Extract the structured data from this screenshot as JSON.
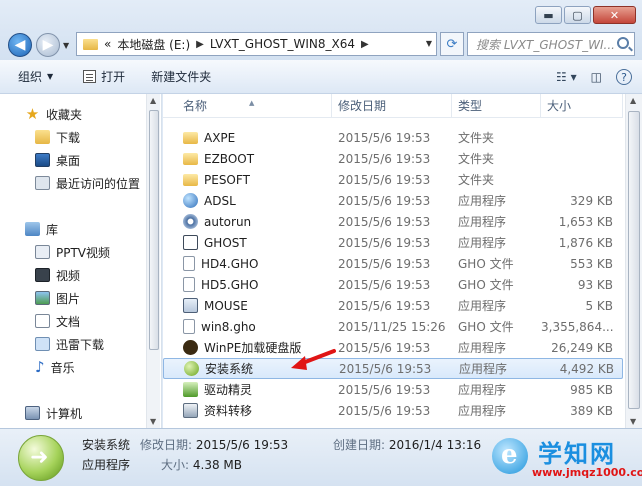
{
  "window": {
    "minimize": "▬",
    "maximize": "▢",
    "close": "✕"
  },
  "address": {
    "overflow": "«",
    "crumbs": [
      "本地磁盘 (E:)",
      "LVXT_GHOST_WIN8_X64"
    ],
    "search_placeholder": "搜索 LVXT_GHOST_WI..."
  },
  "toolbar": {
    "organize": "组织",
    "open": "打开",
    "new_folder": "新建文件夹"
  },
  "nav": {
    "favorites": "收藏夹",
    "downloads": "下载",
    "desktop": "桌面",
    "recent": "最近访问的位置",
    "libraries": "库",
    "pptv": "PPTV视频",
    "videos": "视频",
    "pictures": "图片",
    "documents": "文档",
    "xunlei": "迅雷下载",
    "music": "音乐",
    "computer": "计算机"
  },
  "columns": {
    "name": "名称",
    "date": "修改日期",
    "type": "类型",
    "size": "大小"
  },
  "files": [
    {
      "name": "AXPE",
      "date": "2015/5/6 19:53",
      "type": "文件夹",
      "size": "",
      "icon": "folder-icon"
    },
    {
      "name": "EZBOOT",
      "date": "2015/5/6 19:53",
      "type": "文件夹",
      "size": "",
      "icon": "folder-icon"
    },
    {
      "name": "PESOFT",
      "date": "2015/5/6 19:53",
      "type": "文件夹",
      "size": "",
      "icon": "folder-icon"
    },
    {
      "name": "ADSL",
      "date": "2015/5/6 19:53",
      "type": "应用程序",
      "size": "329 KB",
      "icon": "globe-icon"
    },
    {
      "name": "autorun",
      "date": "2015/5/6 19:53",
      "type": "应用程序",
      "size": "1,653 KB",
      "icon": "gear-icon"
    },
    {
      "name": "GHOST",
      "date": "2015/5/6 19:53",
      "type": "应用程序",
      "size": "1,876 KB",
      "icon": "ghost-icon"
    },
    {
      "name": "HD4.GHO",
      "date": "2015/5/6 19:53",
      "type": "GHO 文件",
      "size": "553 KB",
      "icon": "file-icon"
    },
    {
      "name": "HD5.GHO",
      "date": "2015/5/6 19:53",
      "type": "GHO 文件",
      "size": "93 KB",
      "icon": "file-icon"
    },
    {
      "name": "MOUSE",
      "date": "2015/5/6 19:53",
      "type": "应用程序",
      "size": "5 KB",
      "icon": "app-icon"
    },
    {
      "name": "win8.gho",
      "date": "2015/11/25 15:26",
      "type": "GHO 文件",
      "size": "3,355,864...",
      "icon": "file-icon"
    },
    {
      "name": "WinPE加载硬盘版",
      "date": "2015/5/6 19:53",
      "type": "应用程序",
      "size": "26,249 KB",
      "icon": "pe-icon"
    },
    {
      "name": "安装系统",
      "date": "2015/5/6 19:53",
      "type": "应用程序",
      "size": "4,492 KB",
      "icon": "install-icon"
    },
    {
      "name": "驱动精灵",
      "date": "2015/5/6 19:53",
      "type": "应用程序",
      "size": "985 KB",
      "icon": "driver-icon"
    },
    {
      "name": "资料转移",
      "date": "2015/5/6 19:53",
      "type": "应用程序",
      "size": "389 KB",
      "icon": "migrate-icon"
    }
  ],
  "details": {
    "name": "安装系统",
    "type": "应用程序",
    "modified_label": "修改日期:",
    "modified": "2015/5/6 19:53",
    "size_label": "大小:",
    "size": "4.38 MB",
    "created_label": "创建日期:",
    "created": "2016/1/4 13:16"
  },
  "watermark": {
    "title": "学知网",
    "url": "www.jmqz1000.com"
  },
  "colors": {
    "selection": "#d9e9fb",
    "arrow": "#e01515"
  }
}
